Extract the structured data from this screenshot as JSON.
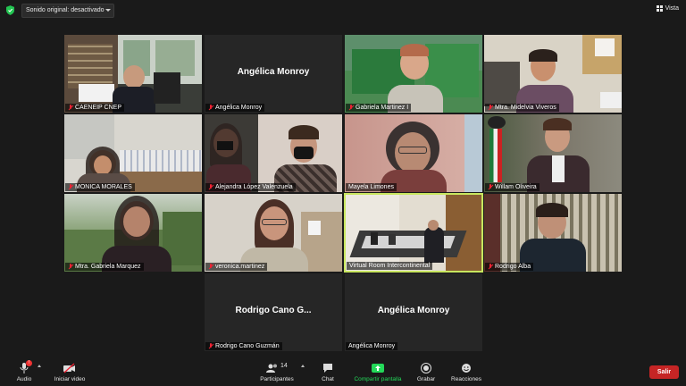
{
  "topbar": {
    "sound_label": "Sonido original: desactivado",
    "view_label": "Vista"
  },
  "tiles": [
    {
      "name": "CAENEIP CNEP",
      "muted": true
    },
    {
      "name": "Angélica Monroy",
      "big": "Angélica Monroy",
      "muted": true
    },
    {
      "name": "Gabriela Martinez I",
      "muted": true
    },
    {
      "name": "Mtra. Midelvia Viveros",
      "muted": true
    },
    {
      "name": "MONICA MORALES",
      "muted": true
    },
    {
      "name": "Alejandra López Valenzuela",
      "muted": true
    },
    {
      "name": "Mayela Limones",
      "muted": false
    },
    {
      "name": "Willam Oliveira",
      "muted": true
    },
    {
      "name": "Mtra. Gabriela Marquez",
      "muted": true
    },
    {
      "name": "veronica.martinez",
      "muted": true
    },
    {
      "name": "Virtual Room Intercontinental",
      "muted": false,
      "active": true
    },
    {
      "name": "Rodrigo Alba",
      "muted": true
    },
    {
      "name": "Rodrigo Cano Guzmán",
      "big": "Rodrigo Cano G...",
      "muted": true
    },
    {
      "name": "Angélica Monroy",
      "big": "Angélica Monroy",
      "muted": false
    }
  ],
  "toolbar": {
    "audio": "Audio",
    "audio_badge": "!",
    "video": "Iniciar video",
    "participants": "Participantes",
    "participants_count": "14",
    "chat": "Chat",
    "share": "Compartir pantalla",
    "record": "Grabar",
    "reactions": "Reacciones",
    "leave": "Salir"
  },
  "colors": {
    "active_border": "#c8e65f",
    "share_green": "#23d959",
    "leave_red": "#c52525"
  }
}
